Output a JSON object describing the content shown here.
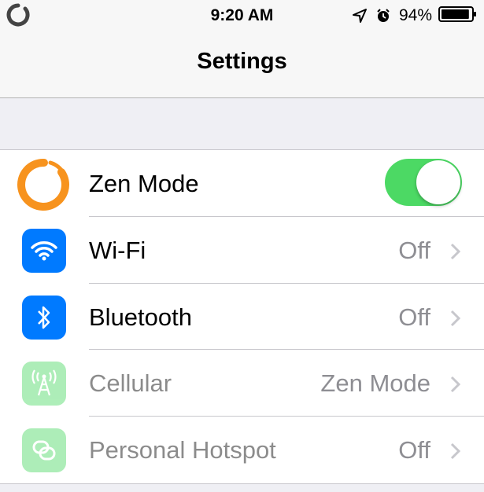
{
  "status_bar": {
    "time": "9:20 AM",
    "battery_percent": "94%",
    "battery_level": 0.94,
    "icons": [
      "app-ring-icon",
      "location-arrow-icon",
      "alarm-icon",
      "battery-icon"
    ]
  },
  "nav": {
    "title": "Settings"
  },
  "colors": {
    "toggle_on": "#4cd964",
    "zen_orange": "#f7931e",
    "wifi_blue": "#007aff",
    "bluetooth_blue": "#007aff",
    "cellular_green": "#4cd964",
    "hotspot_green": "#4cd964"
  },
  "settings": {
    "rows": [
      {
        "label": "Zen Mode",
        "icon": "zen-ring-icon",
        "toggle_on": true
      },
      {
        "label": "Wi-Fi",
        "icon": "wifi-icon",
        "value": "Off"
      },
      {
        "label": "Bluetooth",
        "icon": "bluetooth-icon",
        "value": "Off"
      },
      {
        "label": "Cellular",
        "icon": "cellular-antenna-icon",
        "value": "Zen Mode",
        "disabled": true
      },
      {
        "label": "Personal Hotspot",
        "icon": "hotspot-link-icon",
        "value": "Off",
        "disabled": true
      }
    ]
  }
}
